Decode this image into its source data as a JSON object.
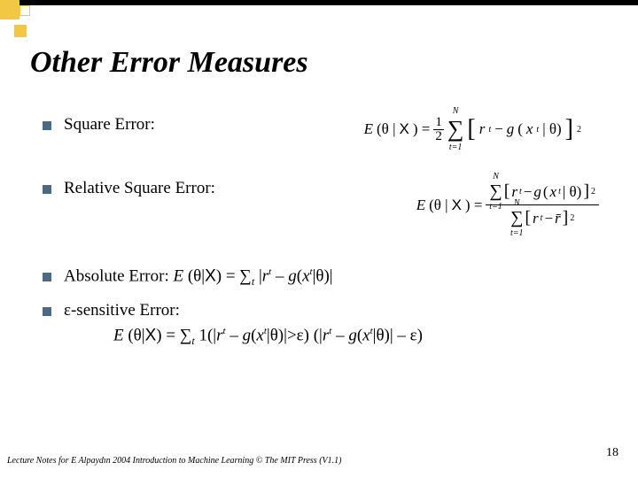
{
  "title": "Other Error Measures",
  "items": {
    "square": "Square Error:",
    "relative": "Relative Square Error:",
    "absolute_prefix": "Absolute Error: ",
    "epsilon": "ε-sensitive Error:"
  },
  "formulas": {
    "square_error_desc": "E(θ|X) = (1/2) Σ_{t=1}^{N} [ r^t − g(x^t|θ) ]^2",
    "relative_square_error_desc": "E(θ|X) = Σ_{t=1}^{N} [r^t − g(x^t|θ)]^2  /  Σ_{t=1}^{N} [r^t − r̄]^2",
    "absolute_error_desc": "E (θ|X) = Σ_t |r^t − g(x^t|θ)|",
    "epsilon_error_desc": "E (θ|X) = Σ_t 1(|r^t − g(x^t|θ)|>ε) (|r^t − g(x^t|θ)| − ε)"
  },
  "footer": "Lecture Notes for E Alpaydın 2004 Introduction to Machine Learning © The MIT Press (V1.1)",
  "page": "18"
}
